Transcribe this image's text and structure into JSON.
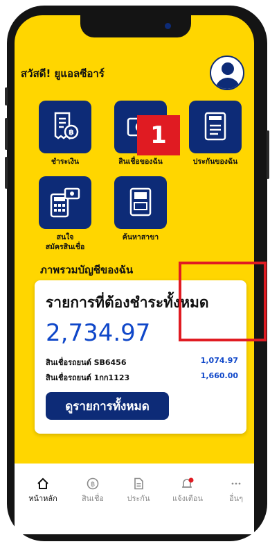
{
  "header": {
    "greeting": "สวัสดี! ยูแอลซีอาร์"
  },
  "menu": {
    "items": [
      {
        "label": "ชำระเงิน",
        "icon": "bill-payment-icon"
      },
      {
        "label": "สินเชื่อของฉัน",
        "icon": "loan-money-icon"
      },
      {
        "label": "ประกันของฉัน",
        "icon": "insurance-document-icon"
      },
      {
        "label_line1": "สนใจ",
        "label_line2": "สมัครสินเชื่อ",
        "icon": "apply-loan-calculator-icon"
      },
      {
        "label": "ค้นหาสาขา",
        "icon": "branch-locator-icon"
      }
    ]
  },
  "overlay": {
    "step_number": "1"
  },
  "accounts": {
    "section_title": "ภาพรวมบัญชีของฉัน",
    "card_title": "รายการที่ต้องชำระทั้งหมด",
    "total_amount": "2,734.97",
    "loans": [
      {
        "name": "สินเชื่อรถยนต์ SB6456",
        "amount": "1,074.97"
      },
      {
        "name": "สินเชื่อรถยนต์ 1กก1123",
        "amount": "1,660.00"
      }
    ],
    "view_all_label": "ดูรายการทั้งหมด"
  },
  "bottom_nav": {
    "items": [
      {
        "label": "หน้าหลัก",
        "icon": "home-icon",
        "active": true
      },
      {
        "label": "สินเชื่อ",
        "icon": "baht-coin-icon",
        "active": false
      },
      {
        "label": "ประกัน",
        "icon": "document-icon",
        "active": false
      },
      {
        "label": "แจ้งเตือน",
        "icon": "bell-icon",
        "active": false
      },
      {
        "label": "อื่นๆ",
        "icon": "more-icon",
        "active": false
      }
    ]
  },
  "colors": {
    "brand_yellow": "#ffd600",
    "brand_navy": "#0d2b77",
    "amount_blue": "#0f47c9",
    "highlight_red": "#e01b22"
  }
}
